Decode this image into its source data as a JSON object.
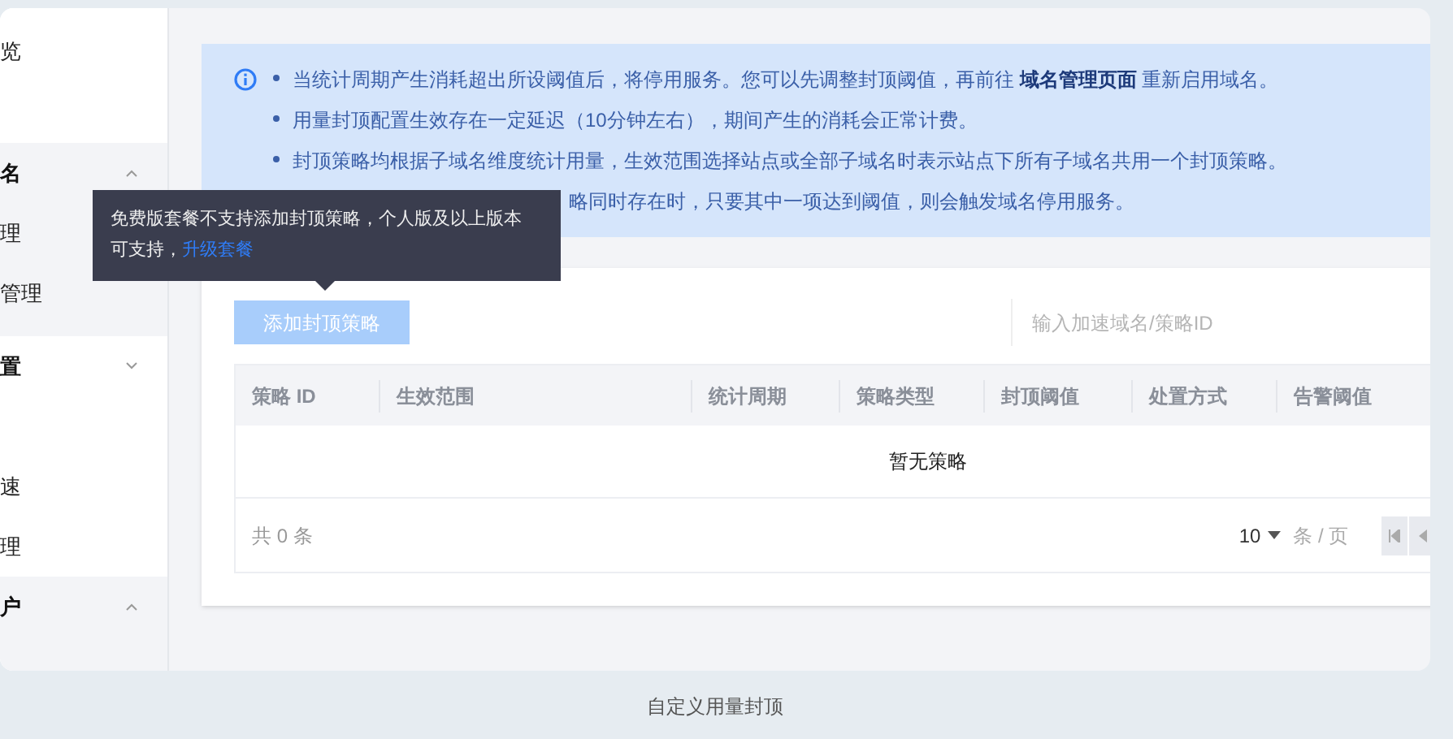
{
  "sidebar": {
    "sections": [
      {
        "shaded": false,
        "items": [
          {
            "kind": "link",
            "label": "览"
          }
        ]
      },
      {
        "shaded": true,
        "items": [
          {
            "kind": "group",
            "label": "名",
            "expanded": true
          },
          {
            "kind": "link",
            "label": "理"
          },
          {
            "kind": "link",
            "label": "管理"
          }
        ]
      },
      {
        "shaded": false,
        "items": [
          {
            "kind": "group",
            "label": "置",
            "expanded": false
          },
          {
            "kind": "link",
            "label": "速"
          },
          {
            "kind": "link",
            "label": "理"
          }
        ]
      },
      {
        "shaded": true,
        "items": [
          {
            "kind": "group",
            "label": "户",
            "expanded": true
          }
        ]
      }
    ]
  },
  "notice": {
    "lines": [
      {
        "text": "当统计周期产生消耗超出所设阈值后，将停用服务。您可以先调整封顶阈值，再前往 **域名管理页面** 重新启用域名。",
        "covered": false
      },
      {
        "text": "用量封顶配置生效存在一定延迟（10分钟左右），期间产生的消耗会正常计费。",
        "covered": false
      },
      {
        "text": "封顶策略均根据子域名维度统计用量，生效范围选择站点或全部子域名时表示站点下所有子域名共用一个封顶策略。",
        "covered": false
      },
      {
        "text": "略同时存在时，只要其中一项达到阈值，则会触发域名停用服务。",
        "covered": true
      }
    ]
  },
  "tooltip": {
    "text": "免费版套餐不支持添加封顶策略，个人版及以上版本可支持，",
    "link": "升级套餐"
  },
  "add_button": {
    "label": "添加封顶策略",
    "disabled": true
  },
  "search": {
    "placeholder": "输入加速域名/策略ID"
  },
  "table": {
    "columns": [
      "策略 ID",
      "生效范围",
      "统计周期",
      "策略类型",
      "封顶阈值",
      "处置方式",
      "告警阈值"
    ],
    "empty_text": "暂无策略"
  },
  "pagination": {
    "total": "共 0 条",
    "page_size": "10",
    "per_page": "条 / 页"
  },
  "caption": "自定义用量封顶"
}
